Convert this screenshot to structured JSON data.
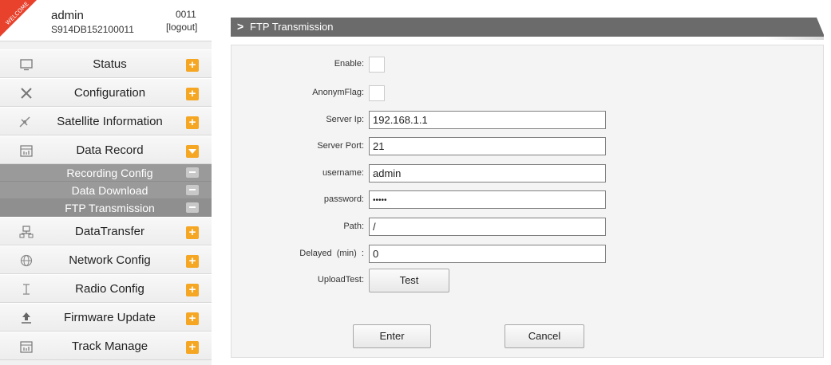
{
  "user": {
    "ribbon_text": "WELCOME",
    "name": "admin",
    "device_id": "S914DB152100011",
    "code": "0011",
    "logout": "[logout]"
  },
  "menu": [
    {
      "label": "Status",
      "icon": "monitor-icon",
      "glyph": "🖵",
      "toggle": "+"
    },
    {
      "label": "Configuration",
      "icon": "tools-icon",
      "glyph": "✕",
      "toggle": "+"
    },
    {
      "label": "Satellite Information",
      "icon": "satellite-icon",
      "glyph": "✶",
      "toggle": "+"
    },
    {
      "label": "Data Record",
      "icon": "calendar-icon",
      "glyph": "▦",
      "toggle": "−"
    },
    {
      "label": "DataTransfer",
      "icon": "network-transfer-icon",
      "glyph": "⊞",
      "toggle": "+"
    },
    {
      "label": "Network Config",
      "icon": "globe-icon",
      "glyph": "⊕",
      "toggle": "+"
    },
    {
      "label": "Radio Config",
      "icon": "radio-antenna-icon",
      "glyph": "Ⲧ",
      "toggle": "+"
    },
    {
      "label": "Firmware Update",
      "icon": "upload-icon",
      "glyph": "⇪",
      "toggle": "+"
    },
    {
      "label": "Track Manage",
      "icon": "calendar-icon",
      "glyph": "▦",
      "toggle": "+"
    }
  ],
  "submenu": [
    {
      "label": "Recording Config"
    },
    {
      "label": "Data Download"
    },
    {
      "label": "FTP Transmission"
    }
  ],
  "page": {
    "title_arrow": ">",
    "title": "FTP Transmission"
  },
  "form": {
    "enable_label": "Enable:",
    "anonym_label": "AnonymFlag:",
    "server_ip_label": "Server Ip:",
    "server_ip": "192.168.1.1",
    "server_port_label": "Server Port:",
    "server_port": "21",
    "username_label": "username:",
    "username": "admin",
    "password_label": "password:",
    "password": "•••••",
    "path_label": "Path:",
    "path": "/",
    "delayed_label": "Delayed  (min)  :",
    "delayed": "0",
    "upload_label": "UploadTest:",
    "test_button": "Test",
    "enter_button": "Enter",
    "cancel_button": "Cancel"
  },
  "colors": {
    "accent_orange": "#f5a623",
    "title_bar": "#6b6b6b",
    "submenu_bg": "#9a9a9a",
    "ribbon_red": "#e8412c"
  }
}
